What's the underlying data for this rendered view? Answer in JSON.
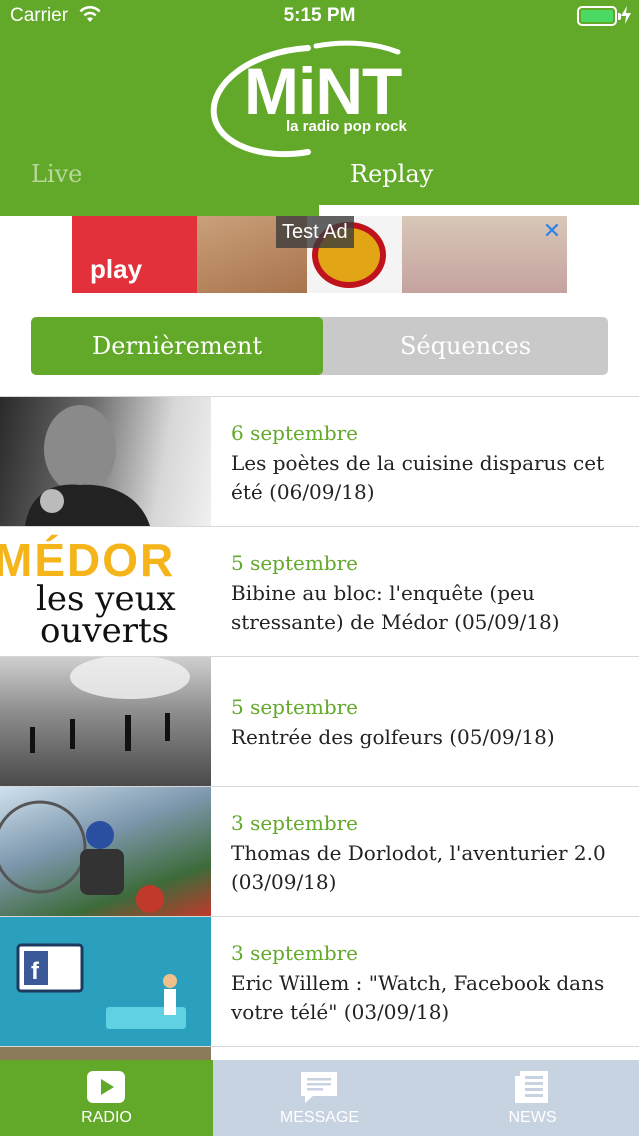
{
  "status": {
    "carrier": "Carrier",
    "time": "5:15 PM"
  },
  "logo": {
    "name": "MiNT",
    "tagline": "la radio pop rock"
  },
  "tabs": {
    "live": "Live",
    "replay": "Replay"
  },
  "ad": {
    "label": "Test Ad",
    "close": "✕",
    "brand": "play"
  },
  "segments": {
    "recent": "Dernièrement",
    "sequences": "Séquences"
  },
  "episodes": [
    {
      "date": "6 septembre",
      "title": "Les poètes de la cuisine disparus cet été (06/09/18)"
    },
    {
      "date": "5 septembre",
      "title": "Bibine au bloc:  l'enquête (peu stressante) de Médor (05/09/18)"
    },
    {
      "date": "5 septembre",
      "title": "Rentrée des golfeurs (05/09/18)"
    },
    {
      "date": "3 septembre",
      "title": "Thomas de Dorlodot, l'aventurier 2.0 (03/09/18)"
    },
    {
      "date": "3 septembre",
      "title": "Eric Willem : \"Watch, Facebook dans votre télé\" (03/09/18)"
    }
  ],
  "thumb_medor": {
    "line1": "MÉDOR",
    "line2": "les yeux",
    "line3": "ouverts"
  },
  "tabbar": {
    "radio": "RADIO",
    "message": "MESSAGE",
    "news": "NEWS"
  },
  "colors": {
    "brand_green": "#62a829",
    "tabbar_inactive": "#c8d3e1"
  }
}
